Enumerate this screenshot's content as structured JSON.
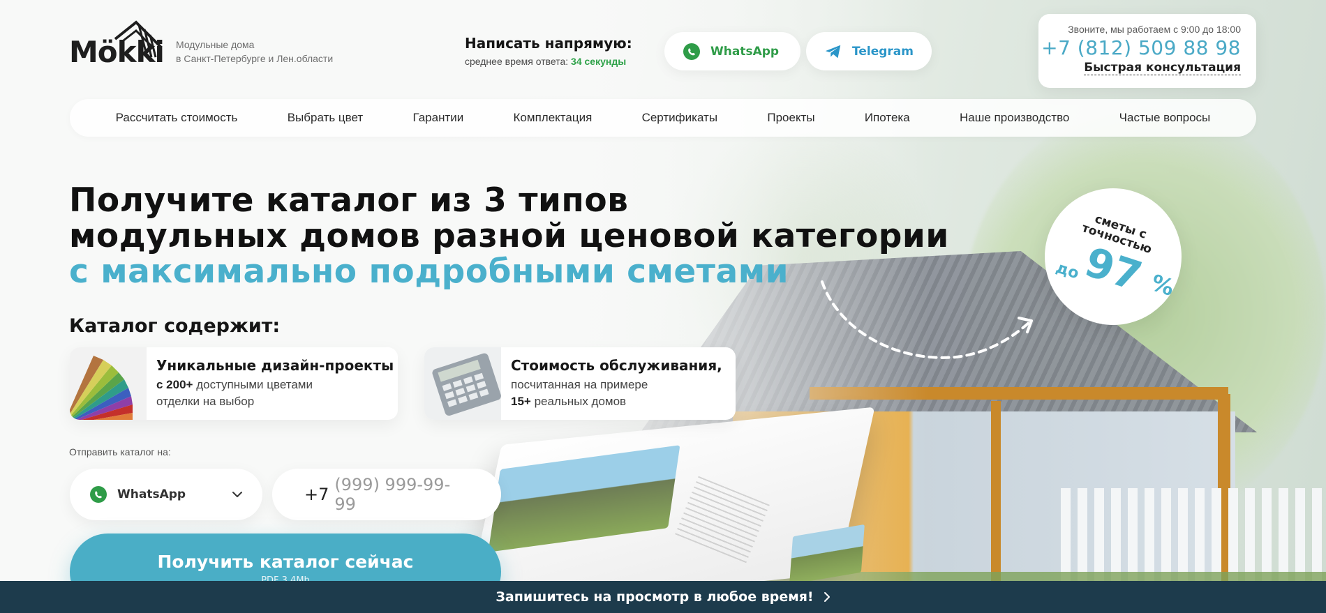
{
  "header": {
    "logo_text": "Mökki",
    "tagline_line1": "Модульные дома",
    "tagline_line2": "в Санкт-Петербурге и Лен.области",
    "write_title": "Написать напрямую:",
    "write_sub_prefix": "среднее время ответа:",
    "write_sub_value": "34 секунды",
    "whatsapp_label": "WhatsApp",
    "telegram_label": "Telegram",
    "hours": "Звоните, мы работаем с 9:00 до 18:00",
    "phone": "+7 (812) 509 88 98",
    "consult": "Быстрая консультация"
  },
  "nav": {
    "items": [
      {
        "label": "Рассчитать стоимость"
      },
      {
        "label": "Выбрать цвет"
      },
      {
        "label": "Гарантии"
      },
      {
        "label": "Комплектация"
      },
      {
        "label": "Сертификаты"
      },
      {
        "label": "Проекты"
      },
      {
        "label": "Ипотека"
      },
      {
        "label": "Наше производство"
      },
      {
        "label": "Частые вопросы"
      }
    ]
  },
  "hero": {
    "title_line1": "Получите каталог из 3 типов",
    "title_line2": "модульных домов разной ценовой категории",
    "title_line3": "с максимально подробными сметами",
    "badge_top": "сметы с точностью",
    "badge_pre": "до",
    "badge_num": "97",
    "badge_pct": "%"
  },
  "catalog": {
    "contains_title": "Каталог содержит:",
    "features": [
      {
        "title": "Уникальные дизайн-проекты",
        "desc_bold": "с 200+",
        "desc_rest": " доступными цветами",
        "desc_line2": "отделки на выбор"
      },
      {
        "title": "Стоимость обслуживания,",
        "desc_line1": "посчитанная на примере",
        "desc_bold": "15+",
        "desc_rest": " реальных домов"
      }
    ]
  },
  "form": {
    "send_label": "Отправить каталог на:",
    "select_value": "WhatsApp",
    "phone_prefix": "+7",
    "phone_placeholder": "(999) 999-99-99",
    "cta_label": "Получить каталог сейчас",
    "cta_sub": "PDF 3,4Mb"
  },
  "bottom_bar": {
    "label": "Запишитесь на просмотр в любое время!"
  },
  "colors": {
    "accent": "#4ab0cc",
    "whatsapp": "#2f9c48",
    "telegram": "#2a95c8",
    "bottom_bar": "#1d3b4c"
  }
}
